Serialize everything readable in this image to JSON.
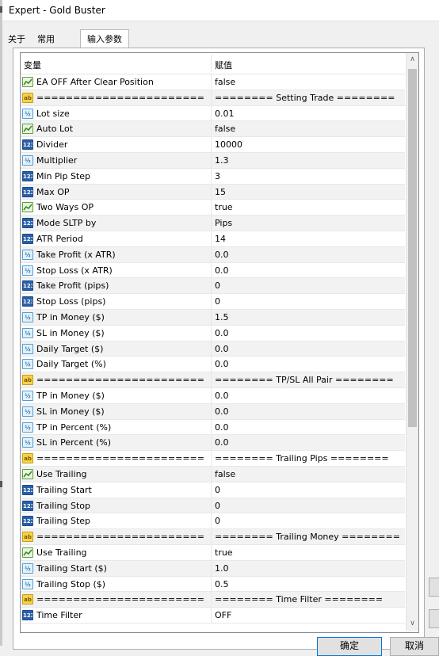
{
  "window": {
    "title": "Expert - Gold Buster"
  },
  "tabs": [
    {
      "label": "关于",
      "active": false
    },
    {
      "label": "常用",
      "active": false
    },
    {
      "label": "输入参数",
      "active": true
    }
  ],
  "grid": {
    "columns": {
      "variable": "变量",
      "value": "赋值"
    },
    "rows": [
      {
        "type": "bool",
        "icon": "bool-icon",
        "name": "EA OFF After Clear Position",
        "value": "false"
      },
      {
        "type": "str",
        "icon": "string-icon",
        "name": "=======================",
        "value": "======== Setting Trade ========"
      },
      {
        "type": "dbl",
        "icon": "double-icon",
        "name": "Lot size",
        "value": "0.01"
      },
      {
        "type": "bool",
        "icon": "bool-icon",
        "name": "Auto Lot",
        "value": "false"
      },
      {
        "type": "num",
        "icon": "integer-icon",
        "name": "Divider",
        "value": "10000"
      },
      {
        "type": "dbl",
        "icon": "double-icon",
        "name": "Multiplier",
        "value": "1.3"
      },
      {
        "type": "num",
        "icon": "integer-icon",
        "name": "Min Pip Step",
        "value": "3"
      },
      {
        "type": "num",
        "icon": "integer-icon",
        "name": "Max OP",
        "value": "15"
      },
      {
        "type": "bool",
        "icon": "bool-icon",
        "name": "Two Ways OP",
        "value": "true"
      },
      {
        "type": "num",
        "icon": "integer-icon",
        "name": "Mode SLTP by",
        "value": "Pips"
      },
      {
        "type": "num",
        "icon": "integer-icon",
        "name": "ATR Period",
        "value": "14"
      },
      {
        "type": "dbl",
        "icon": "double-icon",
        "name": "Take Profit (x ATR)",
        "value": "0.0"
      },
      {
        "type": "dbl",
        "icon": "double-icon",
        "name": "Stop Loss (x ATR)",
        "value": "0.0"
      },
      {
        "type": "num",
        "icon": "integer-icon",
        "name": "Take Profit (pips)",
        "value": "0"
      },
      {
        "type": "num",
        "icon": "integer-icon",
        "name": "Stop Loss (pips)",
        "value": "0"
      },
      {
        "type": "dbl",
        "icon": "double-icon",
        "name": "TP in Money ($)",
        "value": "1.5"
      },
      {
        "type": "dbl",
        "icon": "double-icon",
        "name": "SL in Money ($)",
        "value": "0.0"
      },
      {
        "type": "dbl",
        "icon": "double-icon",
        "name": "Daily Target ($)",
        "value": "0.0"
      },
      {
        "type": "dbl",
        "icon": "double-icon",
        "name": "Daily Target (%)",
        "value": "0.0"
      },
      {
        "type": "str",
        "icon": "string-icon",
        "name": "=======================",
        "value": "======== TP/SL All Pair ========"
      },
      {
        "type": "dbl",
        "icon": "double-icon",
        "name": "TP in Money ($)",
        "value": "0.0"
      },
      {
        "type": "dbl",
        "icon": "double-icon",
        "name": "SL in Money ($)",
        "value": "0.0"
      },
      {
        "type": "dbl",
        "icon": "double-icon",
        "name": "TP in Percent (%)",
        "value": "0.0"
      },
      {
        "type": "dbl",
        "icon": "double-icon",
        "name": "SL in Percent (%)",
        "value": "0.0"
      },
      {
        "type": "str",
        "icon": "string-icon",
        "name": "=======================",
        "value": "======== Trailing Pips ========"
      },
      {
        "type": "bool",
        "icon": "bool-icon",
        "name": "Use Trailing",
        "value": "false"
      },
      {
        "type": "num",
        "icon": "integer-icon",
        "name": "Trailing Start",
        "value": "0"
      },
      {
        "type": "num",
        "icon": "integer-icon",
        "name": "Trailing Stop",
        "value": "0"
      },
      {
        "type": "num",
        "icon": "integer-icon",
        "name": "Trailing Step",
        "value": "0"
      },
      {
        "type": "str",
        "icon": "string-icon",
        "name": "=======================",
        "value": "======== Trailing Money ========"
      },
      {
        "type": "bool",
        "icon": "bool-icon",
        "name": "Use Trailing",
        "value": "true"
      },
      {
        "type": "dbl",
        "icon": "double-icon",
        "name": "Trailing Start ($)",
        "value": "1.0"
      },
      {
        "type": "dbl",
        "icon": "double-icon",
        "name": "Trailing Stop ($)",
        "value": "0.5"
      },
      {
        "type": "str",
        "icon": "string-icon",
        "name": "=======================",
        "value": "======== Time Filter ========"
      },
      {
        "type": "num",
        "icon": "integer-icon",
        "name": "Time Filter",
        "value": "OFF"
      }
    ]
  },
  "icon_glyphs": {
    "num": "123",
    "dbl": "½",
    "str": "ab"
  },
  "buttons": {
    "ok": "确定",
    "cancel": "取消"
  },
  "colors": {
    "selection": "#0078d7",
    "int_icon": "#2a5fa8",
    "bool_icon": "#5e9e3c",
    "string_icon": "#f7d348"
  }
}
